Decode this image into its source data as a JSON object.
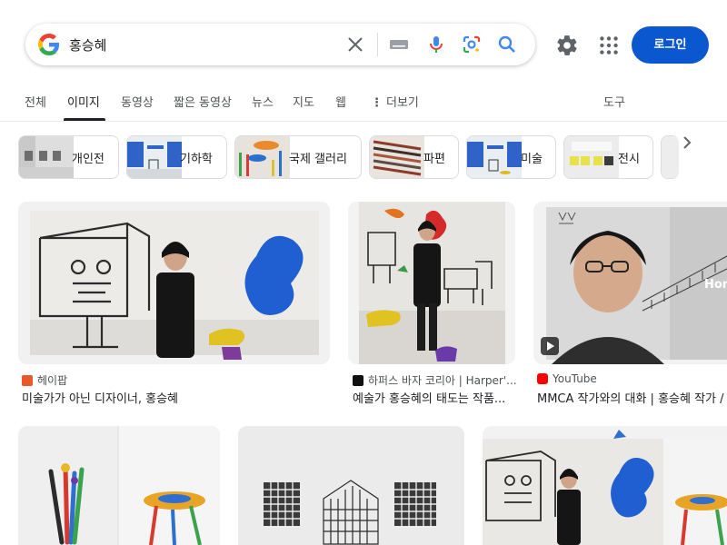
{
  "search": {
    "query": "홍승혜"
  },
  "header": {
    "login_label": "로그인"
  },
  "tabs": [
    {
      "label": "전체"
    },
    {
      "label": "이미지"
    },
    {
      "label": "동영상"
    },
    {
      "label": "짧은 동영상"
    },
    {
      "label": "뉴스"
    },
    {
      "label": "지도"
    },
    {
      "label": "웹"
    },
    {
      "label": "더보기"
    },
    {
      "label": "도구"
    }
  ],
  "chips": [
    {
      "label": "개인전"
    },
    {
      "label": "기하학"
    },
    {
      "label": "국제 갤러리"
    },
    {
      "label": "파편"
    },
    {
      "label": "미술"
    },
    {
      "label": "전시"
    }
  ],
  "results": [
    {
      "source": "헤이팝",
      "title": "미술가가 아닌 디자이너, 홍승혜"
    },
    {
      "source": "하퍼스 바자 코리아 | Harper'...",
      "title": "예술가 홍승혜의 태도는 작품..."
    },
    {
      "source": "YouTube",
      "title": "MMCA 작가와의 대화 | 홍승혜 작가 /"
    }
  ],
  "video_overlay_text": "Hor",
  "colors": {
    "accent": "#0b57d0",
    "youtube": "#ff0000"
  },
  "icons": [
    "google-g-icon",
    "clear-icon",
    "keyboard-icon",
    "mic-icon",
    "lens-icon",
    "search-icon",
    "settings-icon",
    "apps-icon",
    "chevron-right-icon",
    "play-icon"
  ]
}
